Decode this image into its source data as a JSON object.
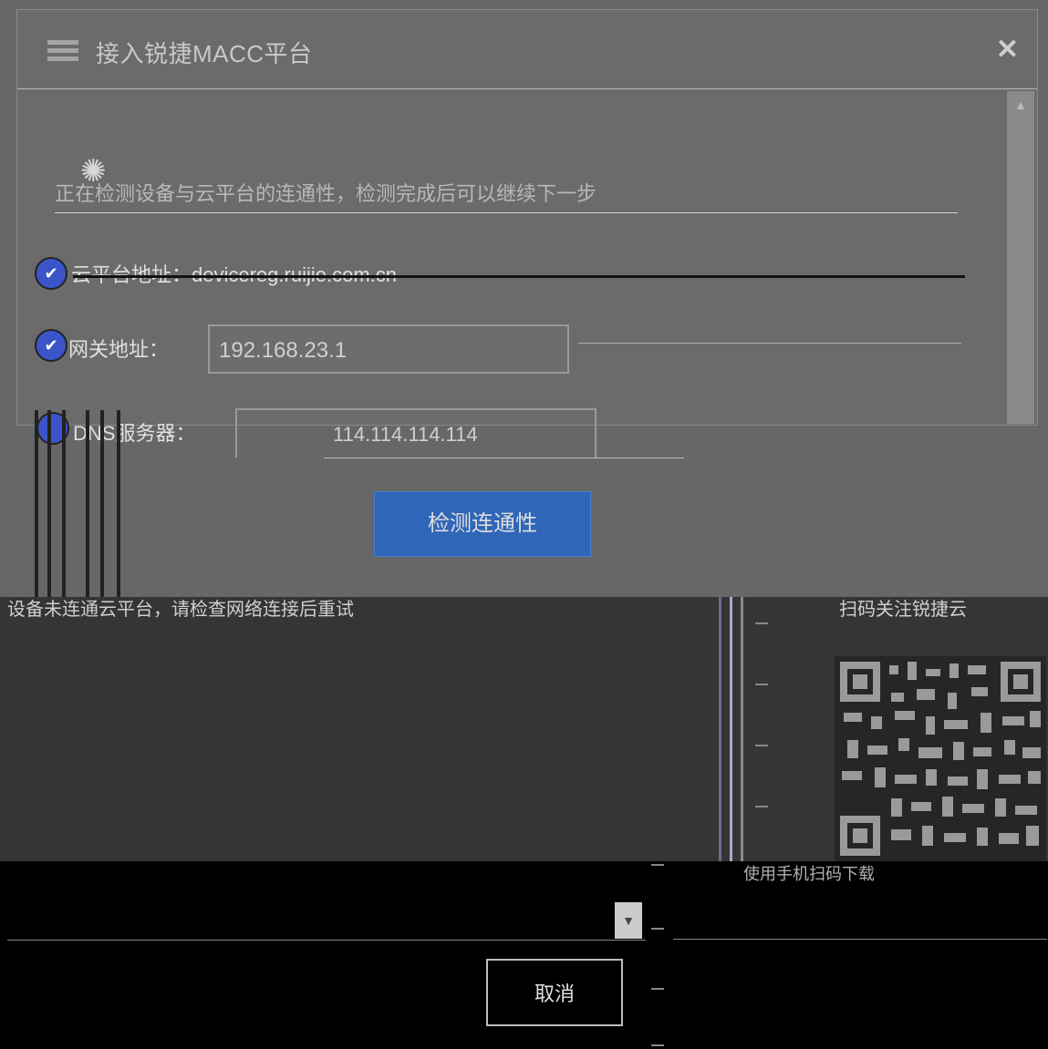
{
  "dialog": {
    "title": "接入锐捷MACC平台",
    "close_symbol": "✕",
    "spinner_symbol": "✺"
  },
  "notice": {
    "text": "正在检测设备与云平台的连通性，检测完成后可以继续下一步"
  },
  "checks": {
    "device_sn_label": "云平台地址：",
    "device_sn_value": "devicereg.ruijie.com.cn",
    "gateway_label": "网关地址：",
    "gateway_value": "192.168.23.1",
    "dns_label": "DNS服务器：",
    "dns_value": "114.114.114.114",
    "check_mark": "✔"
  },
  "buttons": {
    "check_connectivity": "检测连通性",
    "cancel": "取消"
  },
  "footer": {
    "notice": "设备未连通云平台，请检查网络连接后重试",
    "qr_title": "扫码关注锐捷云",
    "qr_caption": "使用手机扫码下载"
  },
  "select": {
    "arrow_symbol": "▼"
  }
}
